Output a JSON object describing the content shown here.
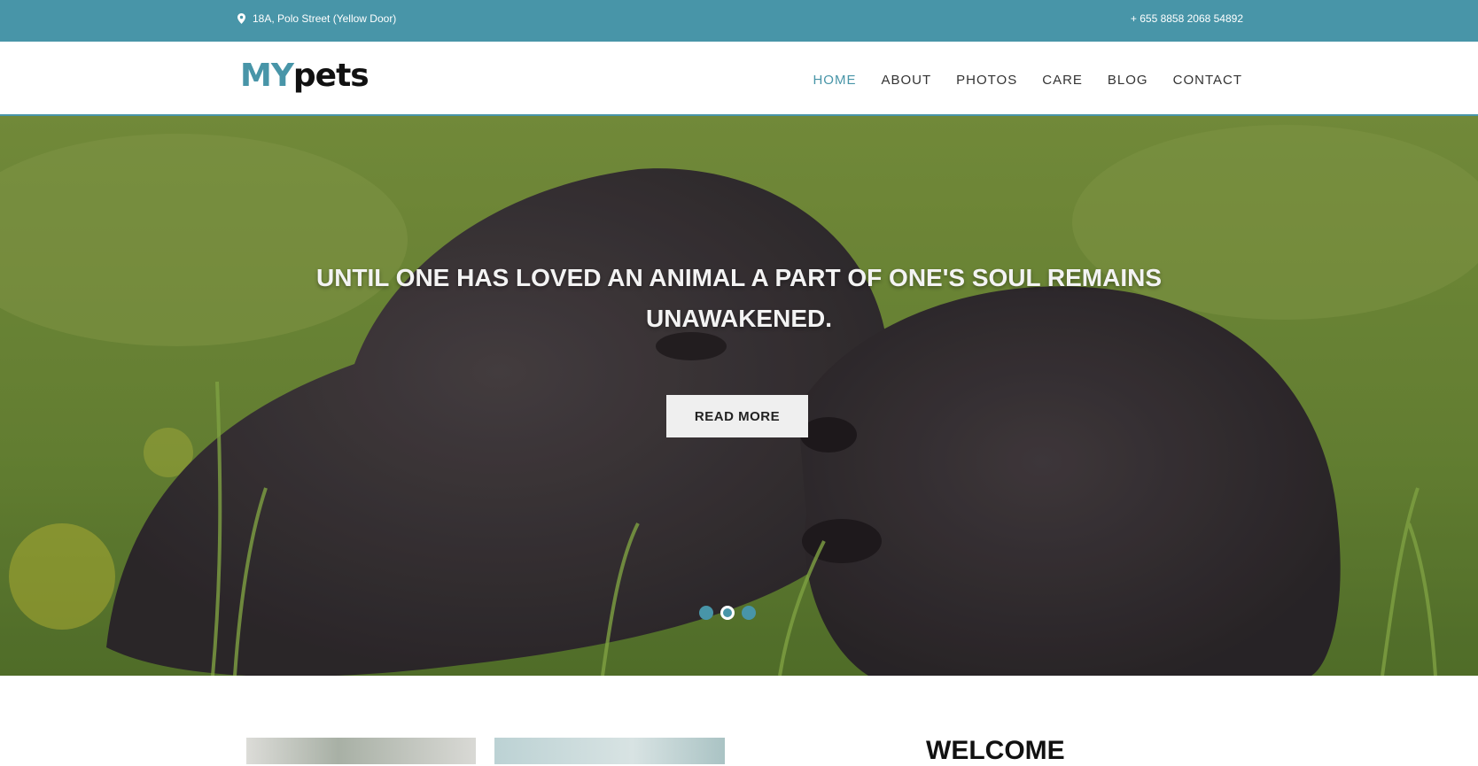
{
  "topbar": {
    "address": "18A, Polo Street (Yellow Door)",
    "phone": "+ 655 8858 2068 54892"
  },
  "brand": {
    "part1": "MY",
    "part2": "pets"
  },
  "nav": {
    "items": [
      {
        "label": "HOME"
      },
      {
        "label": "ABOUT"
      },
      {
        "label": "PHOTOS"
      },
      {
        "label": "CARE"
      },
      {
        "label": "BLOG"
      },
      {
        "label": "CONTACT"
      }
    ],
    "active": "HOME"
  },
  "hero": {
    "headline": "UNTIL ONE HAS LOVED AN ANIMAL A PART OF ONE'S SOUL REMAINS UNAWAKENED.",
    "button": "READ MORE",
    "slides": 3,
    "active_slide": 2
  },
  "section": {
    "heading": "WELCOME"
  },
  "colors": {
    "accent": "#4895a8"
  },
  "icons": {
    "address": "map-marker-icon"
  }
}
